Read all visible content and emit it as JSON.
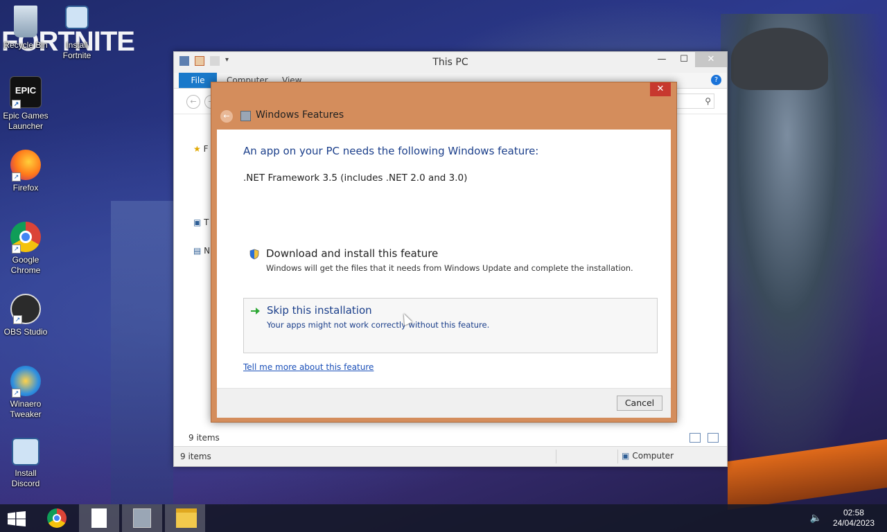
{
  "desktop": {
    "wallpaper_text": "FORTNITE",
    "icons": [
      {
        "label": "Recycle Bin",
        "icon": "recycle-bin-icon"
      },
      {
        "label": "Install Fortnite",
        "icon": "installer-icon"
      },
      {
        "label": "Epic Games Launcher",
        "icon": "epic-games-icon",
        "badge": "EPIC"
      },
      {
        "label": "Firefox",
        "icon": "firefox-icon"
      },
      {
        "label": "Google Chrome",
        "icon": "chrome-icon"
      },
      {
        "label": "OBS Studio",
        "icon": "obs-icon"
      },
      {
        "label": "Winaero Tweaker",
        "icon": "winaero-icon"
      },
      {
        "label": "Install Discord",
        "icon": "installer-icon"
      }
    ]
  },
  "explorer": {
    "title": "This PC",
    "ribbon": {
      "file": "File",
      "computer": "Computer",
      "view": "View"
    },
    "nav_pane": {
      "favorites": "F",
      "this_pc": "T",
      "network": "N"
    },
    "status_upper": "9 items",
    "statusbar": {
      "items": "9 items",
      "computer": "Computer"
    }
  },
  "dialog": {
    "title": "Windows Features",
    "heading": "An app on your PC needs the following Windows feature:",
    "feature": ".NET Framework 3.5 (includes .NET 2.0 and 3.0)",
    "option_download": {
      "title": "Download and install this feature",
      "subtitle": "Windows will get the files that it needs from Windows Update and complete the installation."
    },
    "option_skip": {
      "title": "Skip this installation",
      "subtitle": "Your apps might not work correctly without this feature."
    },
    "link": "Tell me more about this feature",
    "cancel": "Cancel"
  },
  "taskbar": {
    "time": "02:58",
    "date": "24/04/2023"
  },
  "colors": {
    "dialog_frame": "#d48d5c",
    "link_blue": "#1a3e8a",
    "file_tab": "#1979ca",
    "close_red": "#c7382e"
  }
}
